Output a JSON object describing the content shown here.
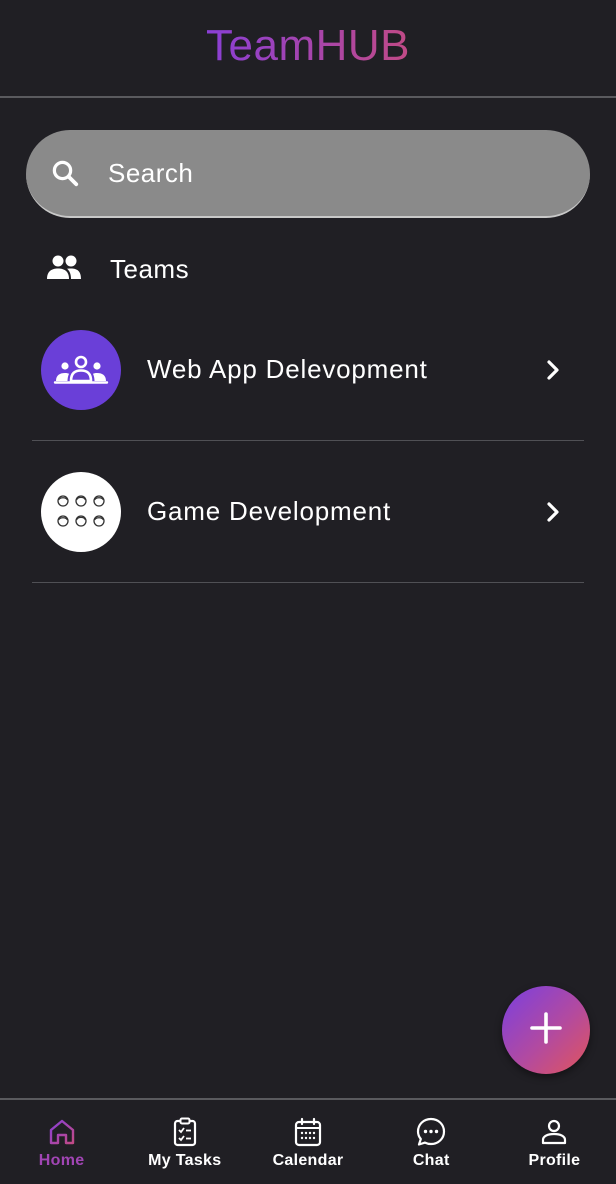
{
  "header": {
    "title": "TeamHUB"
  },
  "search": {
    "placeholder": "Search"
  },
  "section": {
    "label": "Teams"
  },
  "teams": [
    {
      "name": "Web App Delevopment",
      "avatar_color": "#6a3fd8"
    },
    {
      "name": "Game Development",
      "avatar_color": "#ffffff"
    }
  ],
  "fab": {
    "icon": "plus-icon"
  },
  "nav": {
    "items": [
      {
        "label": "Home",
        "icon": "home-icon",
        "active": true
      },
      {
        "label": "My Tasks",
        "icon": "clipboard-check-icon",
        "active": false
      },
      {
        "label": "Calendar",
        "icon": "calendar-icon",
        "active": false
      },
      {
        "label": "Chat",
        "icon": "chat-bubble-icon",
        "active": false
      },
      {
        "label": "Profile",
        "icon": "person-icon",
        "active": false
      }
    ]
  },
  "colors": {
    "background": "#201f24",
    "accent": "#a145b4",
    "search_bg": "#8a8a8a"
  }
}
